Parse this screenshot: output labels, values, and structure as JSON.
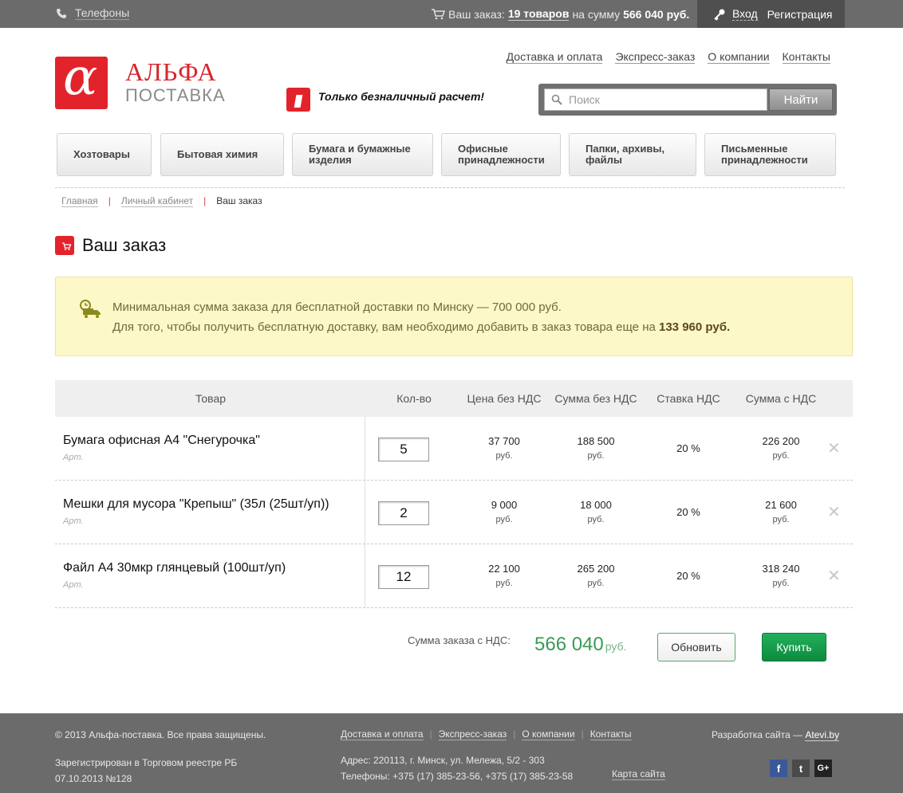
{
  "topbar": {
    "phones_label": "Телефоны",
    "cart_prefix": "Ваш заказ:",
    "cart_count": "19 товаров",
    "cart_mid": "на сумму",
    "cart_sum": "566 040 руб.",
    "login": "Вход",
    "register": "Регистрация"
  },
  "logo": {
    "line1": "АЛЬФА",
    "line2": "ПОСТАВКА",
    "mark": "α"
  },
  "cashless": "Только безналичный расчет!",
  "topnav": [
    "Доставка и оплата",
    "Экспресс-заказ",
    "О компании",
    "Контакты"
  ],
  "search": {
    "placeholder": "Поиск",
    "button": "Найти"
  },
  "categories": [
    {
      "label": "Хозтовары"
    },
    {
      "label": "Бытовая химия"
    },
    {
      "label": "Бумага и бумажные изделия"
    },
    {
      "label": "Офисные принадлежности"
    },
    {
      "label": "Папки, архивы, файлы"
    },
    {
      "label": "Письменные принадлежности"
    }
  ],
  "breadcrumbs": {
    "home": "Главная",
    "account": "Личный кабинет",
    "current": "Ваш заказ"
  },
  "page_title": "Ваш заказ",
  "notice": {
    "line1": "Минимальная сумма заказа для бесплатной доставки по Минску — 700 000 руб.",
    "line2_prefix": "Для того, чтобы получить бесплатную доставку, вам необходимо добавить в заказ товара еще на",
    "line2_amount": "133 960 руб."
  },
  "table": {
    "headers": {
      "product": "Товар",
      "qty": "Кол-во",
      "price": "Цена без НДС",
      "sum": "Сумма без НДС",
      "vat_rate": "Ставка НДС",
      "sum_vat": "Сумма с НДС"
    },
    "currency": "руб.",
    "rows": [
      {
        "name": "Бумага офисная А4 \"Снегурочка\"",
        "art": "Арт.",
        "qty": "5",
        "price": "37 700",
        "sum": "188 500",
        "vat": "20 %",
        "sum_vat": "226 200"
      },
      {
        "name": "Мешки для мусора \"Крепыш\" (35л (25шт/уп))",
        "art": "Арт.",
        "qty": "2",
        "price": "9 000",
        "sum": "18 000",
        "vat": "20 %",
        "sum_vat": "21 600"
      },
      {
        "name": "Файл А4 30мкр глянцевый (100шт/уп)",
        "art": "Арт.",
        "qty": "12",
        "price": "22 100",
        "sum": "265 200",
        "vat": "20 %",
        "sum_vat": "318 240"
      }
    ]
  },
  "total": {
    "label": "Сумма заказа с НДС:",
    "amount": "566 040",
    "currency": "руб."
  },
  "buttons": {
    "update": "Обновить",
    "buy": "Купить"
  },
  "footer": {
    "copyright": "© 2013 Альфа-поставка. Все права защищены.",
    "reg_line1": "Зарегистрирован в Торговом реестре РБ",
    "reg_line2": "07.10.2013 №128",
    "nav": [
      "Доставка и оплата",
      "Экспресс-заказ",
      "О компании",
      "Контакты"
    ],
    "address": "Адрес: 220113, г. Минск, ул. Мележа, 5/2 - 303",
    "phones": "Телефоны: +375 (17) 385-23-56, +375 (17) 385-23-58",
    "sitemap": "Карта сайта",
    "dev_prefix": "Разработка сайта —",
    "dev_link": "Atevi.by",
    "social": [
      {
        "icon": "facebook-icon",
        "glyph": "f",
        "color": "#3b5998"
      },
      {
        "icon": "twitter-icon",
        "glyph": "t",
        "color": "#4a4a4a"
      },
      {
        "icon": "google-plus-icon",
        "glyph": "G+",
        "color": "#222222"
      }
    ]
  },
  "colors": {
    "brand_red": "#e3232b",
    "topbar": "#6b6b6b",
    "green": "#3a9a55",
    "buy_green": "#14954a",
    "notice_bg": "#fdf8c7"
  }
}
